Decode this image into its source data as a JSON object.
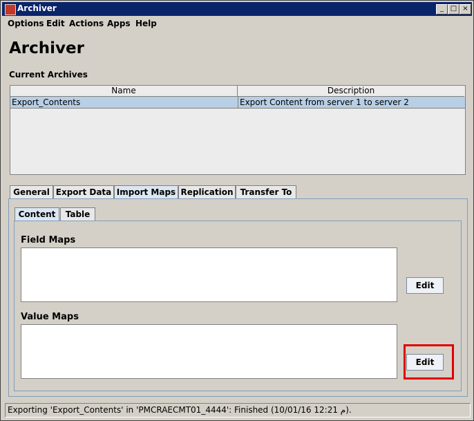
{
  "window": {
    "title": "Archiver",
    "minimize": "_",
    "maximize": "□",
    "close": "×"
  },
  "menu": [
    "Options",
    "Edit",
    "Actions",
    "Apps",
    "Help"
  ],
  "page_title": "Archiver",
  "archives": {
    "label": "Current Archives",
    "columns": [
      "Name",
      "Description"
    ],
    "rows": [
      {
        "name": "Export_Contents",
        "description": "Export Content from server 1 to server 2"
      }
    ]
  },
  "tabs": [
    "General",
    "Export Data",
    "Import Maps",
    "Replication",
    "Transfer To"
  ],
  "active_tab": "Import Maps",
  "subtabs": [
    "Content",
    "Table"
  ],
  "active_subtab": "Content",
  "field_maps": {
    "label": "Field Maps",
    "edit_label": "Edit"
  },
  "value_maps": {
    "label": "Value Maps",
    "edit_label": "Edit"
  },
  "status": "Exporting 'Export_Contents' in 'PMCRAECMT01_4444': Finished (10/01/16 12:21 م)."
}
